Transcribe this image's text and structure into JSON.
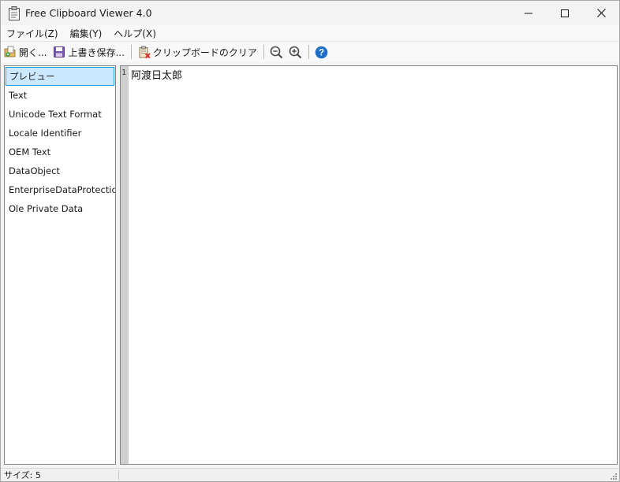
{
  "window": {
    "title": "Free Clipboard Viewer 4.0"
  },
  "menu": [
    {
      "label": "ファイル(Z)"
    },
    {
      "label": "編集(Y)"
    },
    {
      "label": "ヘルプ(X)"
    }
  ],
  "toolbar": {
    "open_label": "開く...",
    "save_label": "上書き保存...",
    "clear_label": "クリップボードのクリア",
    "zoom_out_icon": "zoom-out-icon",
    "zoom_in_icon": "zoom-in-icon",
    "help_icon": "help-icon"
  },
  "formats": [
    {
      "label": "プレビュー",
      "selected": true
    },
    {
      "label": "Text"
    },
    {
      "label": "Unicode Text Format"
    },
    {
      "label": "Locale Identifier"
    },
    {
      "label": "OEM Text"
    },
    {
      "label": "DataObject"
    },
    {
      "label": "EnterpriseDataProtectionId"
    },
    {
      "label": "Ole Private Data"
    }
  ],
  "preview": {
    "line_number": "1",
    "text": "阿渡日太郎"
  },
  "status": {
    "size_text": "サイズ: 5"
  },
  "colors": {
    "selection_bg": "#cce8ff",
    "selection_border": "#26a0da",
    "help_blue": "#1f6fc5",
    "save_purple": "#5b3b8c"
  }
}
